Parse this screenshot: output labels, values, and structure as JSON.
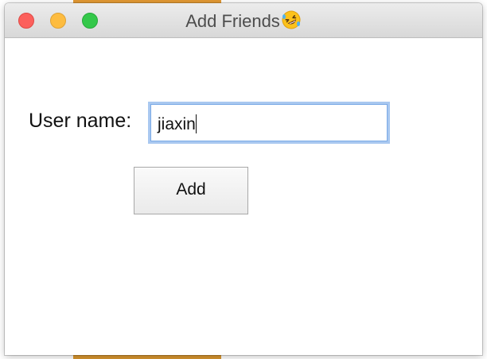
{
  "window": {
    "title": "Add Friends",
    "title_emoji_icon": "rolling-on-floor-laughing-emoji-icon",
    "controls": [
      "close",
      "minimize",
      "zoom"
    ]
  },
  "form": {
    "user_name_label": "User name:",
    "user_name_value": "jiaxin",
    "add_button_label": "Add"
  },
  "colors": {
    "close": "#fc605c",
    "minimize": "#fdbc40",
    "zoom": "#34c84a",
    "focus_ring": "#a9c8f0",
    "background_orange": "#e39a33"
  }
}
